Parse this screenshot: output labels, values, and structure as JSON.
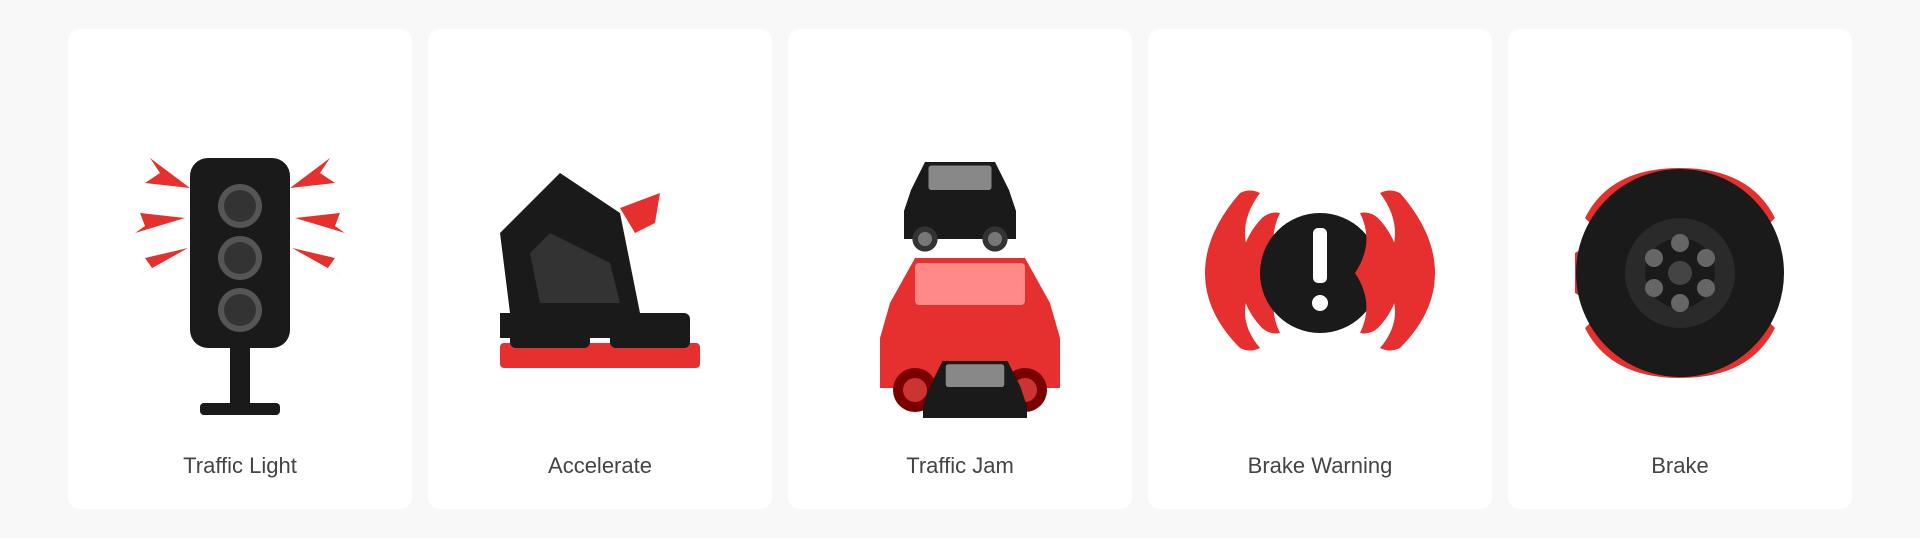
{
  "icons": [
    {
      "id": "traffic-light",
      "label": "Traffic Light"
    },
    {
      "id": "accelerate",
      "label": "Accelerate"
    },
    {
      "id": "traffic-jam",
      "label": "Traffic Jam"
    },
    {
      "id": "brake-warning",
      "label": "Brake Warning"
    },
    {
      "id": "brake",
      "label": "Brake"
    }
  ],
  "colors": {
    "red": "#e63030",
    "black": "#1a1a1a",
    "label": "#555555",
    "background": "#f8f8f8",
    "card": "#ffffff"
  }
}
